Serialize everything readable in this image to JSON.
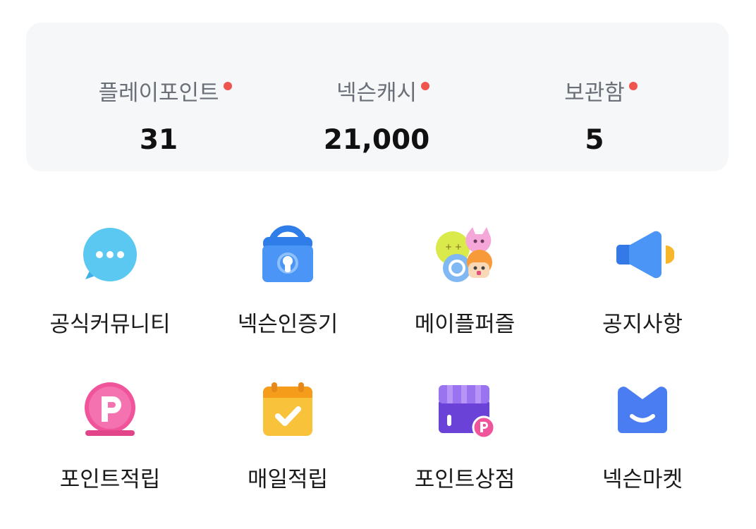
{
  "stats": [
    {
      "label": "플레이포인트",
      "value": "31",
      "has_new": true
    },
    {
      "label": "넥슨캐시",
      "value": "21,000",
      "has_new": true
    },
    {
      "label": "보관함",
      "value": "5",
      "has_new": true
    }
  ],
  "menu": {
    "row1": [
      {
        "label": "공식커뮤니티",
        "icon": "chat-bubble-icon"
      },
      {
        "label": "넥슨인증기",
        "icon": "lock-icon"
      },
      {
        "label": "메이플퍼즐",
        "icon": "puzzle-characters-icon"
      },
      {
        "label": "공지사항",
        "icon": "megaphone-icon"
      }
    ],
    "row2": [
      {
        "label": "포인트적립",
        "icon": "point-coin-icon"
      },
      {
        "label": "매일적립",
        "icon": "calendar-check-icon"
      },
      {
        "label": "포인트상점",
        "icon": "store-icon"
      },
      {
        "label": "넥슨마켓",
        "icon": "market-smile-icon"
      }
    ]
  },
  "colors": {
    "card_bg": "#f6f7f9",
    "dot": "#f0544f",
    "chat": "#5ac8f0",
    "lock": "#3d8cf5",
    "megaphone": "#3d8cf5",
    "point": "#f0559c",
    "calendar": "#f8b62a",
    "store": "#7a52e0",
    "market": "#4477f2"
  }
}
